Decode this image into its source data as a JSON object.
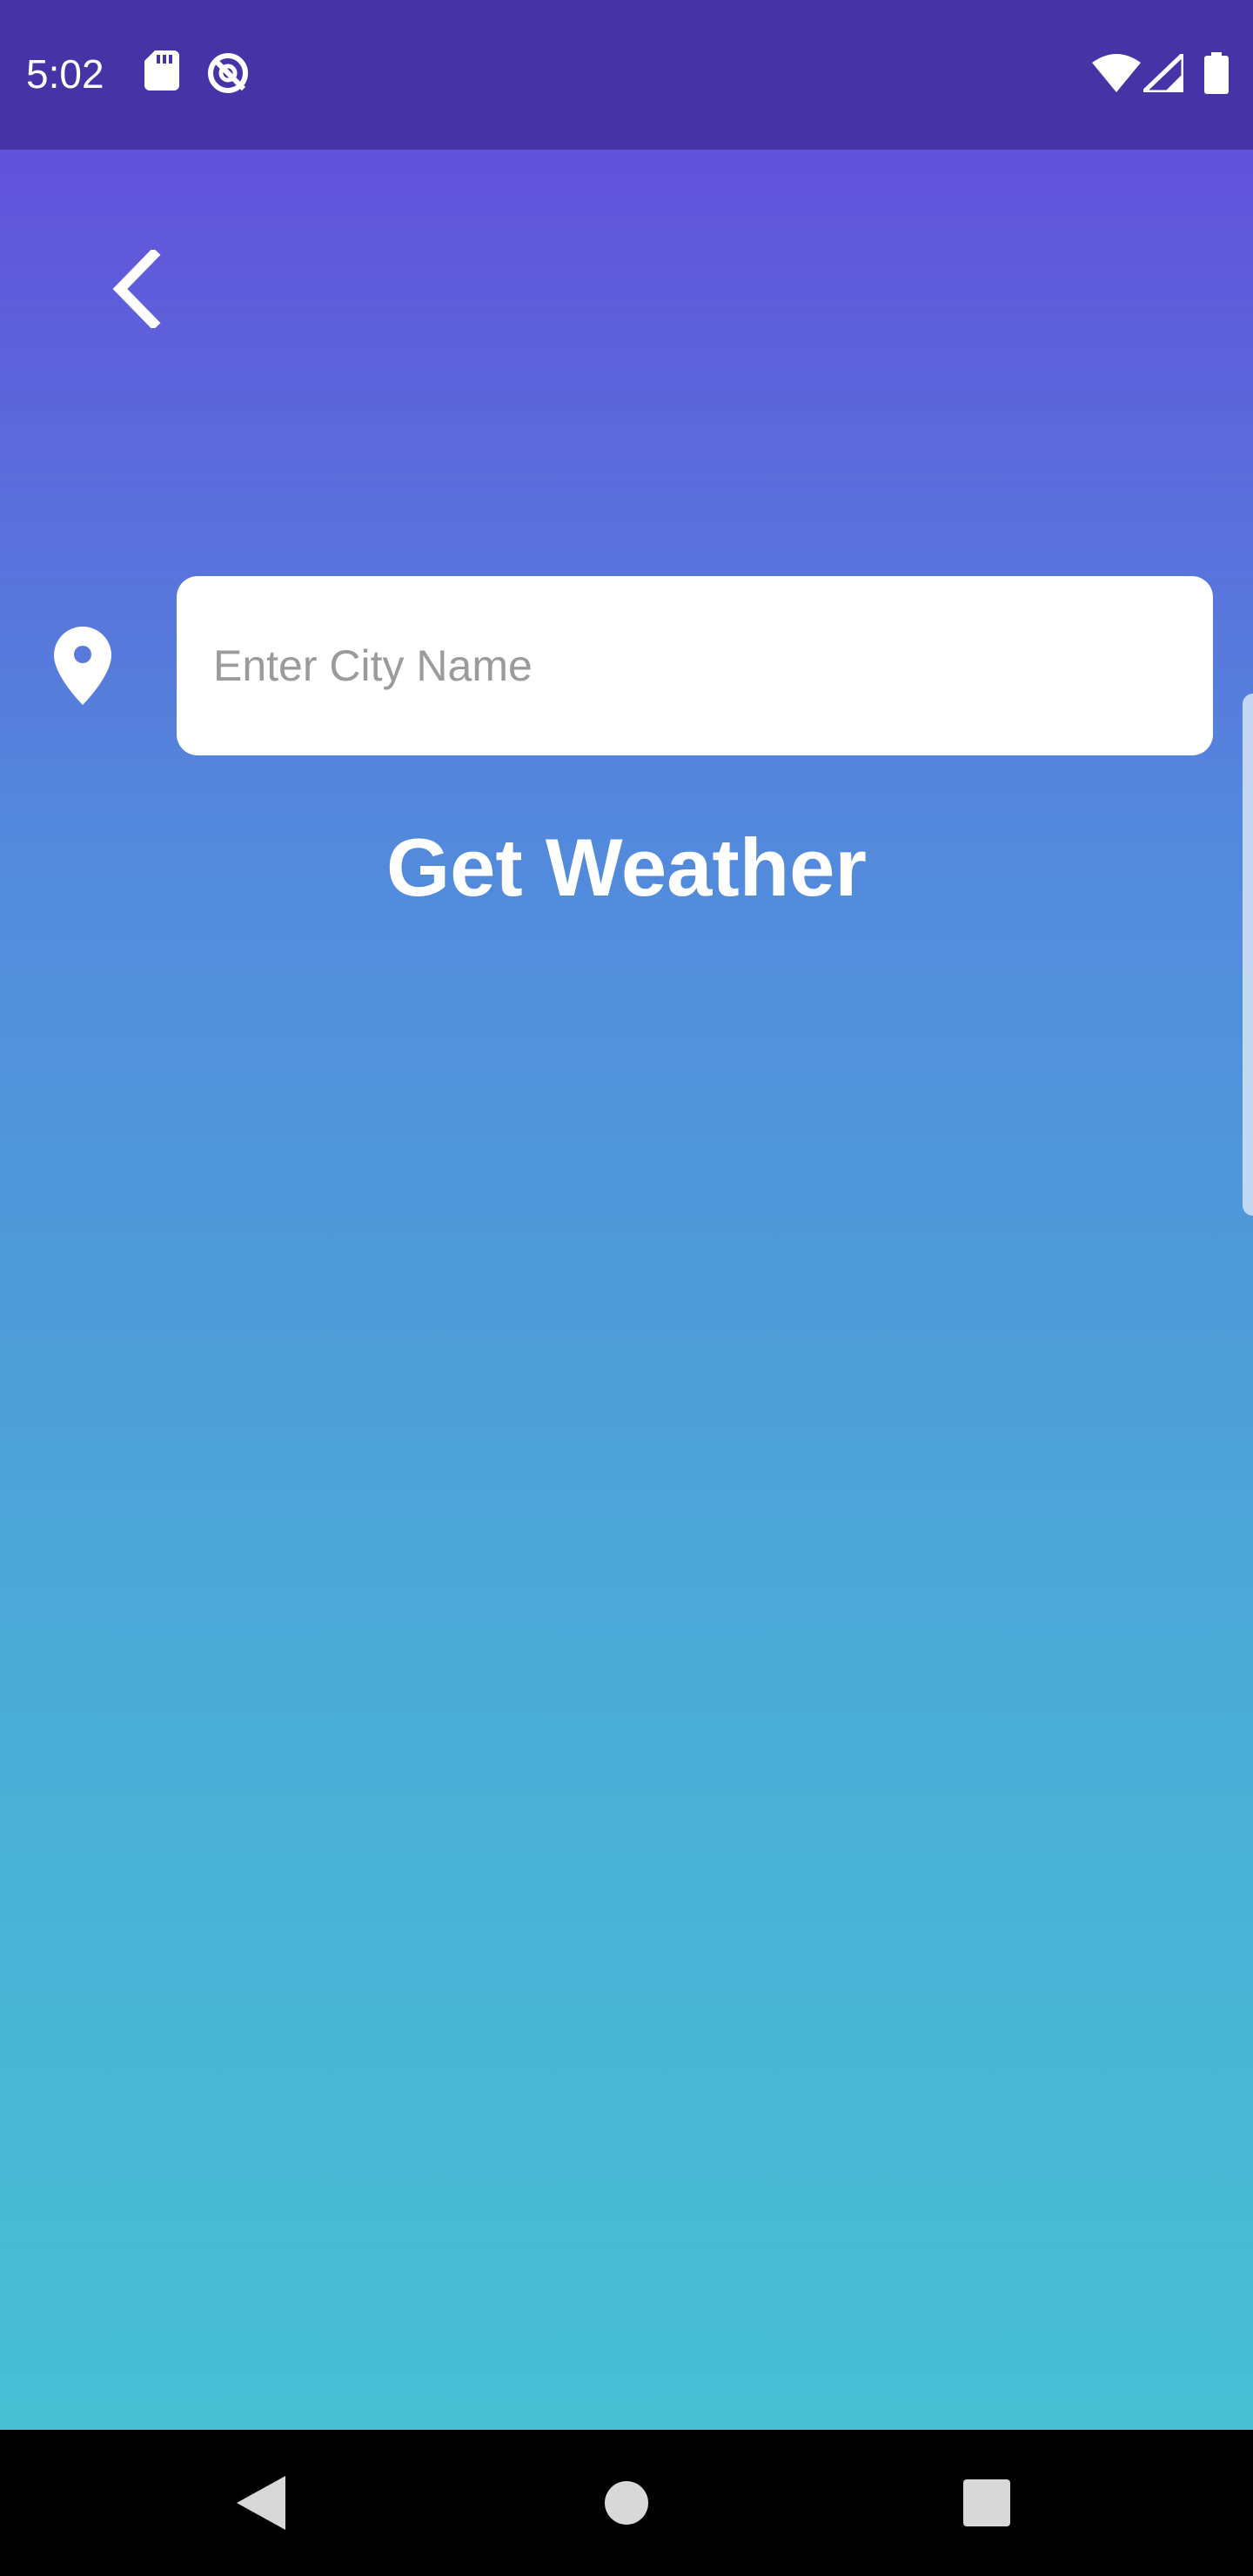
{
  "status_bar": {
    "time": "5:02",
    "left_icons": [
      "sd-card-icon",
      "sync-off-icon"
    ],
    "right_icons": [
      "wifi-icon",
      "cell-signal-icon",
      "battery-icon"
    ],
    "background": "#4634a6"
  },
  "toolbar": {
    "back_icon": "chevron-left-icon"
  },
  "search": {
    "location_icon": "location-pin-icon",
    "placeholder": "Enter City Name",
    "value": ""
  },
  "actions": {
    "get_weather_label": "Get Weather"
  },
  "nav_bar": {
    "buttons": [
      "back-triangle-icon",
      "home-circle-icon",
      "recents-square-icon"
    ]
  },
  "colors": {
    "gradient_top": "#6251db",
    "gradient_bottom": "#48c0d4",
    "text": "#ffffff",
    "placeholder": "#9b9b9b"
  }
}
